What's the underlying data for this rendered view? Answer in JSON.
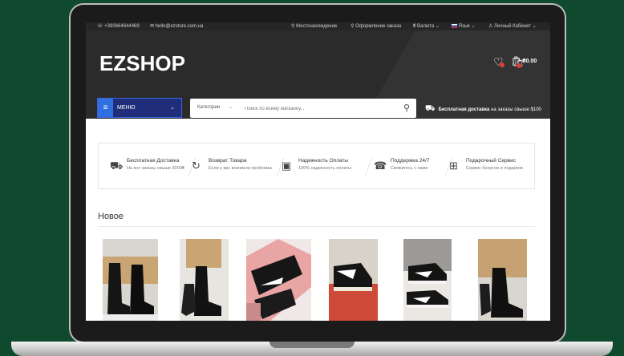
{
  "topbar": {
    "phone": "☏ +380664644469",
    "email": "✉ hello@ezstore.com.ua",
    "location": "⚲ Местонахождение",
    "checkout": "⚲ Оформление заказа",
    "currency": "₴ Валюта ⌄",
    "language": "Язык ⌄",
    "account": "♙ Личный Кабинет ⌄"
  },
  "header": {
    "logo": "EZSHOP",
    "cart_total": "₴0.00",
    "wishlist_count": "0",
    "cart_count": "0"
  },
  "nav": {
    "menu_label": "МЕНЮ",
    "category_label": "Категории",
    "search_placeholder": "Поиск по всему магазину...",
    "shipping_bold": "Бесплатная доставка",
    "shipping_rest": "на заказы свыше $100"
  },
  "features": [
    {
      "title": "Бесплатная Доставка",
      "sub": "На все заказы свыше 3000₴",
      "icon": "truck-icon"
    },
    {
      "title": "Возврат Товара",
      "sub": "Если у вас возникли проблемы",
      "icon": "refresh-icon"
    },
    {
      "title": "Надежность Оплаты",
      "sub": "100% надежность оплаты",
      "icon": "secure-payment-icon"
    },
    {
      "title": "Поддержка 24/7",
      "sub": "Свяжитесь с нами",
      "icon": "support-icon"
    },
    {
      "title": "Подарочный Сервис",
      "sub": "Сервис бонусов и подарков",
      "icon": "gift-icon"
    }
  ],
  "section": {
    "new_title": "Новое"
  },
  "colors": {
    "header_bg": "#2b2b2b",
    "menu_accent": "#2f6fe0",
    "badge": "#e53935",
    "page_bg": "#0f4a2e"
  }
}
